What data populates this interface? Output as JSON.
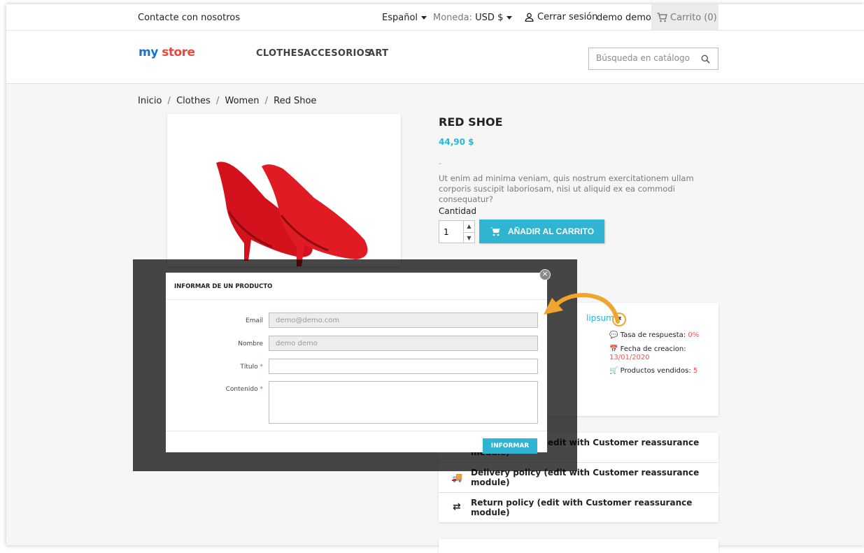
{
  "topbar": {
    "contact": "Contacte con nosotros",
    "language": "Español",
    "currency_label": "Moneda:",
    "currency_value": "USD $",
    "logout": "Cerrar sesión",
    "username": "demo demo",
    "cart": "Carrito (0)"
  },
  "header": {
    "logo_my": "my",
    "logo_store": "store",
    "menu": [
      "CLOTHES",
      "ACCESORIOS",
      "ART"
    ],
    "search_placeholder": "Búsqueda en catálogo"
  },
  "breadcrumb": [
    "Inicio",
    "Clothes",
    "Women",
    "Red Shoe"
  ],
  "product": {
    "title": "RED SHOE",
    "price": "44,90 $",
    "dash": "-",
    "description": "Ut enim ad minima veniam, quis nostrum exercitationem ullam corporis suscipit laboriosam, nisi ut aliquid ex ea commodi consequatur?",
    "qty_label": "Cantidad",
    "qty_value": "1",
    "add_to_cart": "AÑADIR AL CARRITO"
  },
  "seller": {
    "name": "lipsum",
    "response_rate_label": "Tasa de respuesta:",
    "response_rate_value": "0%",
    "created_label": "Fecha de creacion:",
    "created_value": "13/01/2020",
    "sold_label": "Productos vendidos:",
    "sold_value": "5"
  },
  "reassurance": [
    "Security policy (edit with Customer reassurance module)",
    "Delivery policy (edit with Customer reassurance module)",
    "Return policy (edit with Customer reassurance module)"
  ],
  "modal": {
    "title": "INFORMAR DE UN PRODUCTO",
    "email_label": "Email",
    "email_value": "demo@demo.com",
    "name_label": "Nombre",
    "name_value": "demo demo",
    "title_label": "Título",
    "content_label": "Contenido",
    "required_mark": "*",
    "submit": "INFORMAR",
    "close": "×"
  },
  "colors": {
    "accent": "#2fb5d2",
    "required": "#ff4c4c",
    "arrow": "#f0a530"
  }
}
